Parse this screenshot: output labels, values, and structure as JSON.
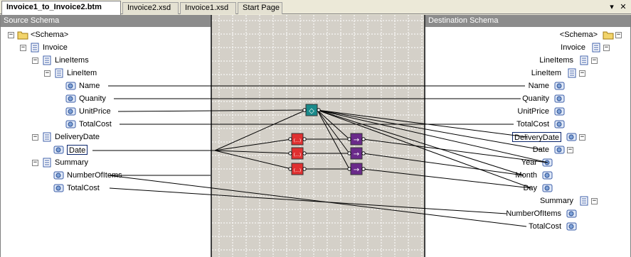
{
  "tabs": [
    {
      "label": "Invoice1_to_Invoice2.btm",
      "active": true
    },
    {
      "label": "Invoice2.xsd",
      "active": false
    },
    {
      "label": "Invoice1.xsd",
      "active": false
    },
    {
      "label": "Start Page",
      "active": false
    }
  ],
  "tab_controls": {
    "dropdown": "▾",
    "close": "✕"
  },
  "source": {
    "header": "Source Schema",
    "nodes": [
      {
        "id": "schema",
        "label": "<Schema>",
        "icon": "folder-icon",
        "expander": "−"
      },
      {
        "id": "invoice",
        "label": "Invoice",
        "icon": "record-icon",
        "expander": "−"
      },
      {
        "id": "lineitems",
        "label": "LineItems",
        "icon": "record-icon",
        "expander": "−"
      },
      {
        "id": "lineitem",
        "label": "LineItem",
        "icon": "record-icon",
        "expander": "−"
      },
      {
        "id": "name",
        "label": "Name",
        "icon": "field-icon"
      },
      {
        "id": "quanity",
        "label": "Quanity",
        "icon": "field-icon"
      },
      {
        "id": "unitprice",
        "label": "UnitPrice",
        "icon": "field-icon"
      },
      {
        "id": "totalcost",
        "label": "TotalCost",
        "icon": "field-icon"
      },
      {
        "id": "deliverydate",
        "label": "DeliveryDate",
        "icon": "record-icon",
        "expander": "−"
      },
      {
        "id": "date",
        "label": "Date",
        "icon": "field-icon",
        "selected": true
      },
      {
        "id": "summary",
        "label": "Summary",
        "icon": "record-icon",
        "expander": "−"
      },
      {
        "id": "numberofitems",
        "label": "NumberOfItems",
        "icon": "field-icon"
      },
      {
        "id": "totalcost2",
        "label": "TotalCost",
        "icon": "field-icon"
      }
    ]
  },
  "destination": {
    "header": "Destination Schema",
    "nodes": [
      {
        "id": "schema",
        "label": "<Schema>",
        "icon": "folder-icon",
        "expander": "−"
      },
      {
        "id": "invoice",
        "label": "Invoice",
        "icon": "record-icon",
        "expander": "−"
      },
      {
        "id": "lineitems",
        "label": "LineItems",
        "icon": "record-icon",
        "expander": "−"
      },
      {
        "id": "lineitem",
        "label": "LineItem",
        "icon": "record-icon",
        "expander": "−"
      },
      {
        "id": "name",
        "label": "Name",
        "icon": "field-icon"
      },
      {
        "id": "quanity",
        "label": "Quanity",
        "icon": "field-icon"
      },
      {
        "id": "unitprice",
        "label": "UnitPrice",
        "icon": "field-icon"
      },
      {
        "id": "totalcost",
        "label": "TotalCost",
        "icon": "field-icon"
      },
      {
        "id": "deliverydate",
        "label": "DeliveryDate",
        "icon": "field-icon",
        "expander": "−",
        "selected": true
      },
      {
        "id": "date",
        "label": "Date",
        "icon": "field-icon",
        "expander": "−"
      },
      {
        "id": "year",
        "label": "Year",
        "icon": "field-icon"
      },
      {
        "id": "month",
        "label": "Month",
        "icon": "field-icon"
      },
      {
        "id": "day",
        "label": "Day",
        "icon": "field-icon"
      },
      {
        "id": "summary",
        "label": "Summary",
        "icon": "record-icon",
        "expander": "−"
      },
      {
        "id": "numberofitems",
        "label": "NumberOfItems",
        "icon": "field-icon"
      },
      {
        "id": "totalcost2",
        "label": "TotalCost",
        "icon": "field-icon"
      }
    ]
  },
  "functoids": [
    {
      "id": "looping-functoid",
      "type": "looping",
      "color": "#1a8a8a",
      "symbol": "◇"
    },
    {
      "id": "string-functoid-1",
      "type": "string",
      "color": "#e03030",
      "symbol": "(...)"
    },
    {
      "id": "string-functoid-2",
      "type": "string",
      "color": "#e03030",
      "symbol": "(...)"
    },
    {
      "id": "string-functoid-3",
      "type": "string",
      "color": "#e03030",
      "symbol": "(...)"
    },
    {
      "id": "conversion-functoid-1",
      "type": "conversion",
      "color": "#6a2a8a",
      "symbol": "→"
    },
    {
      "id": "conversion-functoid-2",
      "type": "conversion",
      "color": "#6a2a8a",
      "symbol": "→"
    },
    {
      "id": "conversion-functoid-3",
      "type": "conversion",
      "color": "#6a2a8a",
      "symbol": "→"
    }
  ],
  "colors": {
    "header_bg": "#8c8c8c",
    "grid_bg": "#d4d0c8",
    "selection_border": "#0a246a"
  }
}
